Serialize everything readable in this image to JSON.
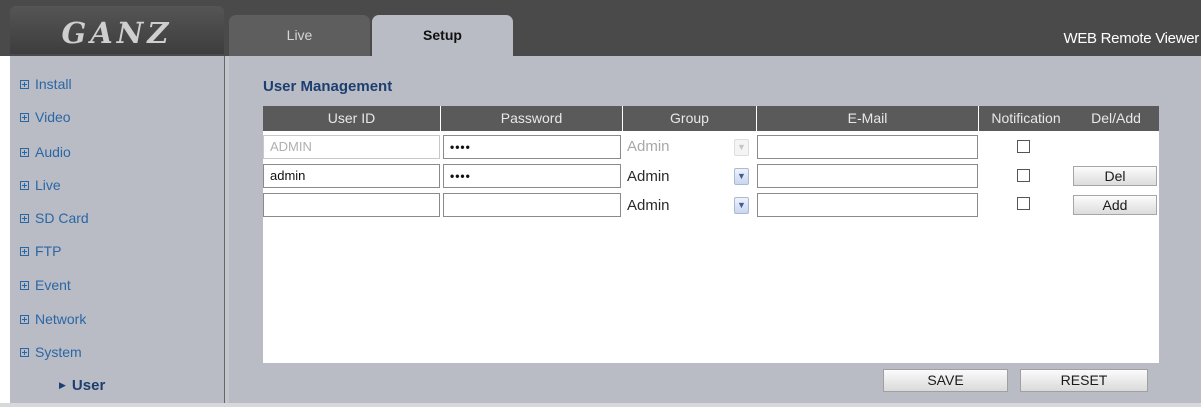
{
  "header": {
    "logo_text": "GANZ",
    "tabs": [
      {
        "label": "Live",
        "active": false
      },
      {
        "label": "Setup",
        "active": true
      }
    ],
    "app_title": "WEB Remote Viewer"
  },
  "sidebar": {
    "items": [
      {
        "label": "Install"
      },
      {
        "label": "Video"
      },
      {
        "label": "Audio"
      },
      {
        "label": "Live"
      },
      {
        "label": "SD Card"
      },
      {
        "label": "FTP"
      },
      {
        "label": "Event"
      },
      {
        "label": "Network"
      },
      {
        "label": "System"
      }
    ],
    "active_subitem": "User"
  },
  "main": {
    "section_title": "User Management",
    "table": {
      "columns": [
        "User ID",
        "Password",
        "Group",
        "E-Mail",
        "Notification",
        "Del/Add"
      ],
      "rows": [
        {
          "user_id": "ADMIN",
          "password": "••••",
          "group": "Admin",
          "email": "",
          "notification": false,
          "action": "",
          "disabled": true
        },
        {
          "user_id": "admin",
          "password": "••••",
          "group": "Admin",
          "email": "",
          "notification": false,
          "action": "Del",
          "disabled": false
        },
        {
          "user_id": "",
          "password": "",
          "group": "Admin",
          "email": "",
          "notification": false,
          "action": "Add",
          "disabled": false
        }
      ]
    },
    "buttons": {
      "save": "SAVE",
      "reset": "RESET"
    }
  },
  "colors": {
    "header_bg": "#4a4a4a",
    "panel_bg": "#b9bcc4",
    "link_blue": "#2a66a6",
    "title_navy": "#1d3f70",
    "table_header_bg": "#5a5a5a"
  },
  "icons": {
    "sidebar_expand": "plus-box-icon",
    "active_marker": "triangle-right-icon",
    "select_arrow": "chevron-down-icon"
  }
}
